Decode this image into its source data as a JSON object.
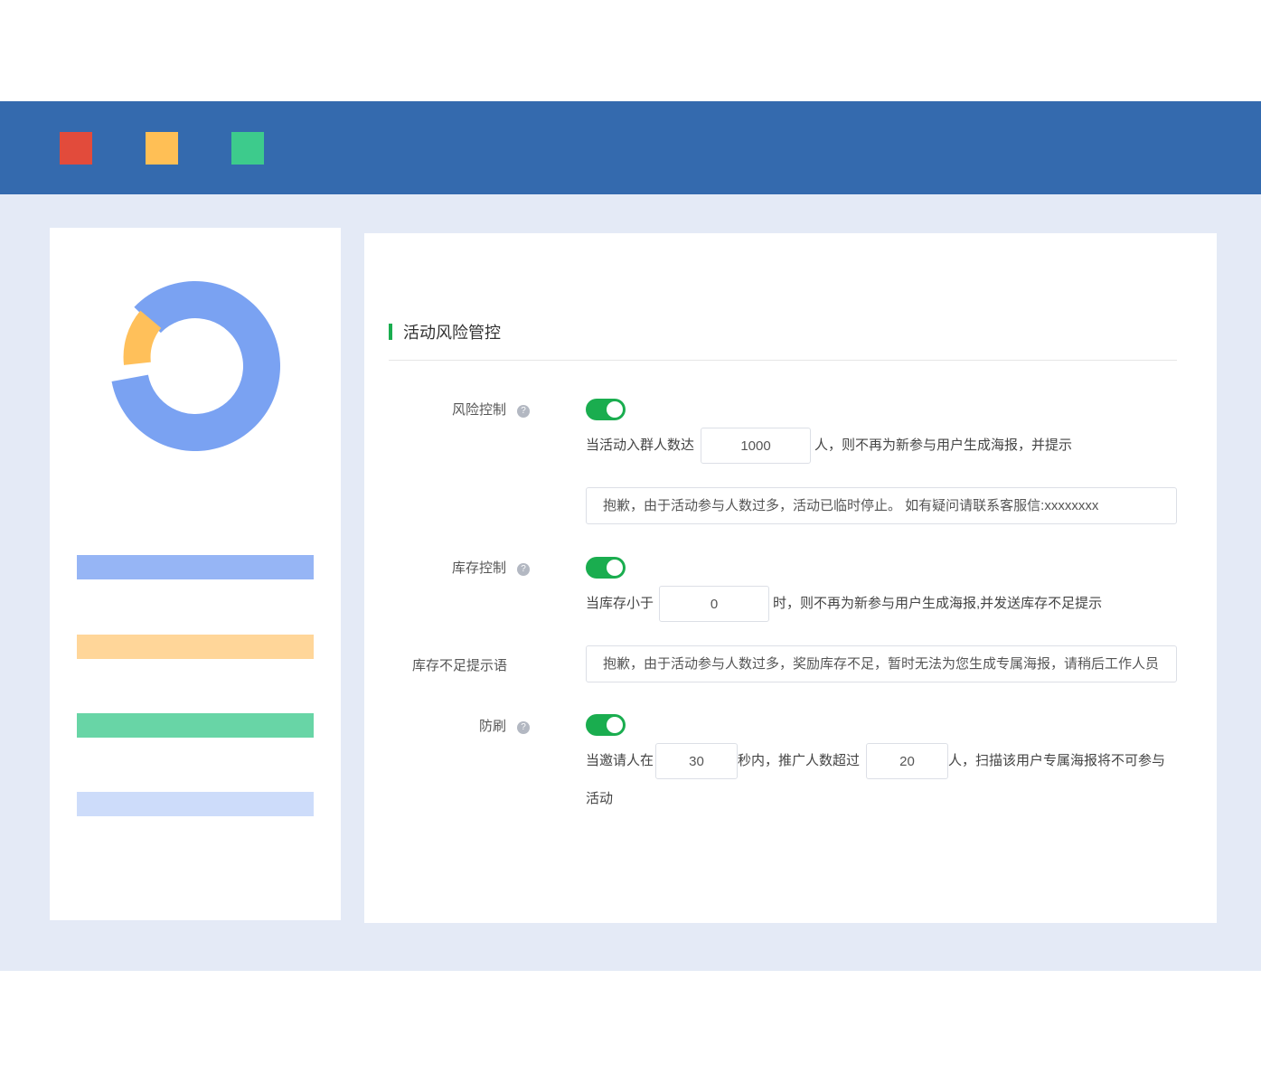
{
  "colors": {
    "titlebar": "#346aae",
    "window_bg": "#e4eaf6",
    "dot_red": "#e24b3b",
    "dot_yellow": "#ffbf55",
    "dot_green": "#3dcb8c",
    "accent_green": "#1aad4f",
    "donut_blue": "#7aa2f2",
    "donut_orange": "#ffc05a",
    "bar_blue": "#96b5f5",
    "bar_orange": "#ffd699",
    "bar_green": "#68d5a6",
    "bar_lightblue": "#cddcfa"
  },
  "sidebar": {
    "donut": {
      "segments": [
        {
          "color": "blue",
          "fraction": 0.86
        },
        {
          "color": "orange",
          "fraction": 0.14
        }
      ]
    }
  },
  "section": {
    "title": "活动风险管控"
  },
  "risk_control": {
    "label": "风险控制",
    "help_icon": "question-icon",
    "enabled": true,
    "prefix": "当活动入群人数达",
    "threshold": "1000",
    "suffix": "人，则不再为新参与用户生成海报，并提示",
    "message": "抱歉，由于活动参与人数过多，活动已临时停止。 如有疑问请联系客服信:xxxxxxxx"
  },
  "stock_control": {
    "label": "库存控制",
    "help_icon": "question-icon",
    "enabled": true,
    "prefix": "当库存小于",
    "threshold": "0",
    "suffix": "时，则不再为新参与用户生成海报,并发送库存不足提示"
  },
  "stock_message": {
    "label": "库存不足提示语",
    "value": "抱歉，由于活动参与人数过多，奖励库存不足，暂时无法为您生成专属海报，请稍后工作人员"
  },
  "anti_fraud": {
    "label": "防刷",
    "help_icon": "question-icon",
    "enabled": true,
    "prefix": "当邀请人在",
    "seconds": "30",
    "middle": "秒内，推广人数超过",
    "count": "20",
    "suffix": "人，扫描该用户专属海报将不可参与",
    "suffix2": "活动"
  }
}
